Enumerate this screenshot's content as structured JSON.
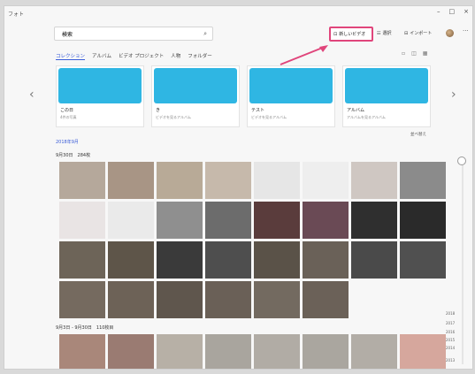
{
  "app": {
    "title": "フォト"
  },
  "window_controls": {
    "minimize": "–",
    "maximize": "□",
    "close": "×"
  },
  "search": {
    "value": "検索",
    "icon": "search-icon"
  },
  "toolbar": {
    "import_label": "新しいビデオ",
    "select_label": "選択",
    "import_btn_label": "インポート",
    "more": "···"
  },
  "tabs": [
    "コレクション",
    "アルバム",
    "ビデオ プロジェクト",
    "人物",
    "フォルダー"
  ],
  "cards": [
    {
      "name": "この日",
      "sub": "4件の写真"
    },
    {
      "name": "き",
      "sub": "ビデオを見るアルバム"
    },
    {
      "name": "テスト",
      "sub": "ビデオを見るアルバム"
    },
    {
      "name": "アルバム",
      "sub": "アルバムを見るアルバム"
    }
  ],
  "sort_label": "並べ替え",
  "month_label": "2018年9月",
  "section1": {
    "date": "9月30日　284枚"
  },
  "section2": {
    "date": "9月3日 - 9月30日　110枚目"
  },
  "timeline": {
    "labels": [
      "2018",
      "2017",
      "2016",
      "2015",
      "2014",
      "2013"
    ]
  },
  "colors": {
    "accent": "#3b5dd8",
    "highlight": "#e0457b",
    "card_thumb": "#2fb6e3"
  }
}
